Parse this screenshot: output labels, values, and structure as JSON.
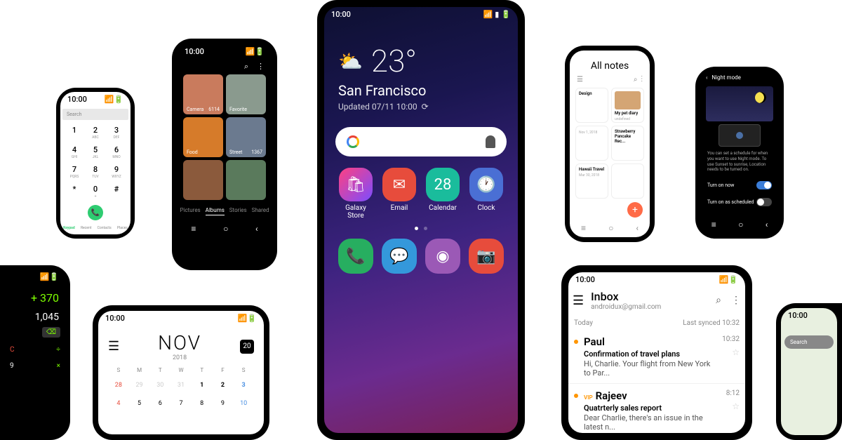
{
  "main": {
    "time": "10:00",
    "weather": {
      "temp": "23°",
      "city": "San Francisco",
      "updated": "Updated 07/11 10:00"
    },
    "apps": [
      {
        "label": "Galaxy\nStore",
        "bg": "linear-gradient(135deg,#ff4081,#7c4dff)",
        "glyph": "🛍"
      },
      {
        "label": "Email",
        "bg": "#e74c3c",
        "glyph": "✉"
      },
      {
        "label": "Calendar",
        "bg": "#1abc9c",
        "glyph": "28"
      },
      {
        "label": "Clock",
        "bg": "#4a6fd4",
        "glyph": "🕐"
      }
    ],
    "dock": [
      {
        "bg": "#27ae60",
        "glyph": "📞"
      },
      {
        "bg": "#3498db",
        "glyph": "💬"
      },
      {
        "bg": "#9b59b6",
        "glyph": "◉"
      },
      {
        "bg": "#e74c3c",
        "glyph": "📷"
      }
    ]
  },
  "dialer": {
    "time": "10:00",
    "search": "Search",
    "keys": [
      {
        "n": "1",
        "s": ""
      },
      {
        "n": "2",
        "s": "ABC"
      },
      {
        "n": "3",
        "s": "DEF"
      },
      {
        "n": "4",
        "s": "GHI"
      },
      {
        "n": "5",
        "s": "JKL"
      },
      {
        "n": "6",
        "s": "MNO"
      },
      {
        "n": "7",
        "s": "PQRS"
      },
      {
        "n": "8",
        "s": "TUV"
      },
      {
        "n": "9",
        "s": "WXYZ"
      },
      {
        "n": "*",
        "s": ""
      },
      {
        "n": "0",
        "s": "+"
      },
      {
        "n": "#",
        "s": ""
      }
    ],
    "tabs": [
      "Keypad",
      "Recent",
      "Contacts",
      "Places"
    ]
  },
  "gallery": {
    "time": "10:00",
    "items": [
      {
        "label": "Camera",
        "count": "6114",
        "bg": "#c97b5d"
      },
      {
        "label": "Favorite",
        "count": "",
        "bg": "#8a9a8e"
      },
      {
        "label": "Food",
        "count": "",
        "bg": "#d67b2a"
      },
      {
        "label": "Street",
        "count": "1367",
        "bg": "#6b7a8f"
      },
      {
        "label": "",
        "count": "",
        "bg": "#8b5a3c"
      },
      {
        "label": "",
        "count": "",
        "bg": "#5a7a5c"
      }
    ],
    "tabs": [
      "Pictures",
      "Albums",
      "Stories",
      "Shared"
    ]
  },
  "calc": {
    "expr": "+ 370",
    "result": "1,045"
  },
  "calendar": {
    "time": "10:00",
    "month": "NOV",
    "year": "2018",
    "today": "20",
    "days": [
      "S",
      "M",
      "T",
      "W",
      "T",
      "F",
      "S"
    ],
    "dates": [
      {
        "d": "28",
        "c": "dim sun"
      },
      {
        "d": "29",
        "c": "dim"
      },
      {
        "d": "30",
        "c": "dim"
      },
      {
        "d": "31",
        "c": "dim"
      },
      {
        "d": "1",
        "c": "bold"
      },
      {
        "d": "2",
        "c": "bold"
      },
      {
        "d": "3",
        "c": "bold sat"
      },
      {
        "d": "4",
        "c": "sun"
      },
      {
        "d": "5",
        "c": ""
      },
      {
        "d": "6",
        "c": ""
      },
      {
        "d": "7",
        "c": ""
      },
      {
        "d": "8",
        "c": ""
      },
      {
        "d": "9",
        "c": ""
      },
      {
        "d": "10",
        "c": "sat"
      }
    ]
  },
  "notes": {
    "title": "All notes",
    "cards": [
      {
        "t": "Design",
        "sub": ""
      },
      {
        "t": "My pet diary",
        "img": true
      },
      {
        "t": "",
        "sub": "Nov 1, 2018"
      },
      {
        "t": "Strawberry Pancake Rec...",
        "sub": ""
      },
      {
        "t": "Hawaii Travel",
        "sub": "Mar 30, 2018"
      },
      {
        "t": "",
        "sub": ""
      }
    ]
  },
  "night": {
    "title": "Night mode",
    "desc": "You can set a schedule for when you want to use Night mode. To use Sunset to sunrise, Location needs to be turned on.",
    "t1": "Turn on now",
    "t2": "Turn on as scheduled"
  },
  "email": {
    "time": "10:00",
    "title": "Inbox",
    "sub": "androidux@gmail.com",
    "today": "Today",
    "synced": "Last synced 10:32",
    "msgs": [
      {
        "from": "Paul",
        "subj": "Confirmation of travel plans",
        "prev": "Hi, Charlie. Your flight from New York to Par...",
        "time": "10:32",
        "vip": false
      },
      {
        "from": "Rajeev",
        "subj": "Quatrterly sales report",
        "prev": "Dear Charlie, there's an issue in the latest n...",
        "time": "8:12",
        "vip": true
      }
    ]
  },
  "map": {
    "time": "10:00",
    "search": "Search"
  }
}
